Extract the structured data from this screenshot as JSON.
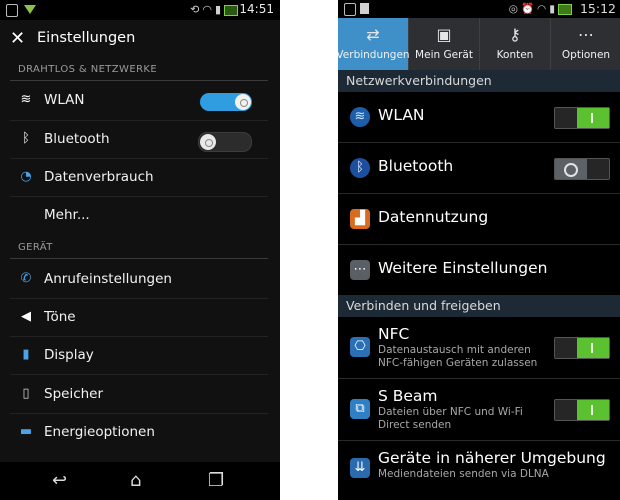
{
  "sony": {
    "status": {
      "time": "14:51"
    },
    "title": "Einstellungen",
    "sections": [
      {
        "header": "DRAHTLOS & NETZWERKE",
        "items": [
          {
            "label": "WLAN",
            "icon": "wifi-icon",
            "toggle": "on"
          },
          {
            "label": "Bluetooth",
            "icon": "bluetooth-icon",
            "toggle": "off"
          },
          {
            "label": "Datenverbrauch",
            "icon": "data-usage-icon"
          },
          {
            "label": "Mehr..."
          }
        ]
      },
      {
        "header": "GERÄT",
        "items": [
          {
            "label": "Anrufeinstellungen",
            "icon": "phone-icon"
          },
          {
            "label": "Töne",
            "icon": "speaker-icon"
          },
          {
            "label": "Display",
            "icon": "display-icon"
          },
          {
            "label": "Speicher",
            "icon": "storage-icon"
          },
          {
            "label": "Energieoptionen",
            "icon": "battery-icon"
          }
        ]
      }
    ],
    "colors": {
      "toggle_on": "#2f9de0",
      "background": "#111112"
    }
  },
  "samsung": {
    "status": {
      "time": "15:12"
    },
    "tabs": [
      {
        "label": "Verbindungen",
        "icon": "connections-icon",
        "active": true
      },
      {
        "label": "Mein Gerät",
        "icon": "my-device-icon"
      },
      {
        "label": "Konten",
        "icon": "accounts-key-icon"
      },
      {
        "label": "Optionen",
        "icon": "options-dots-icon"
      }
    ],
    "sections": [
      {
        "header": "Netzwerkverbindungen",
        "items": [
          {
            "label": "WLAN",
            "icon": "wifi-icon",
            "switch": "on"
          },
          {
            "label": "Bluetooth",
            "icon": "bluetooth-icon",
            "switch": "off"
          },
          {
            "label": "Datennutzung",
            "icon": "data-usage-icon"
          },
          {
            "label": "Weitere Einstellungen",
            "icon": "more-dots-icon"
          }
        ]
      },
      {
        "header": "Verbinden und freigeben",
        "items": [
          {
            "label": "NFC",
            "sub": "Datenaustausch mit anderen NFC-fähigen Geräten zulassen",
            "icon": "nfc-icon",
            "switch": "on"
          },
          {
            "label": "S Beam",
            "sub": "Dateien über NFC und Wi-Fi Direct senden",
            "icon": "s-beam-icon",
            "switch": "on"
          },
          {
            "label": "Geräte in näherer Umgebung",
            "sub": "Mediendateien senden via DLNA",
            "icon": "nearby-devices-icon"
          }
        ]
      }
    ],
    "colors": {
      "active_tab": "#3f8fc9",
      "switch_on": "#5cc131",
      "section_header": "#1d2a35"
    }
  }
}
